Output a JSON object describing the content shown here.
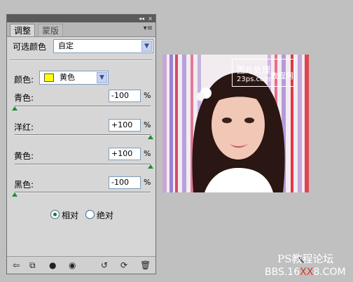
{
  "panel": {
    "tabs": [
      {
        "label": "调整",
        "active": true
      },
      {
        "label": "蒙版",
        "active": false
      }
    ],
    "title_controls": "◂◂",
    "close": "×",
    "menu_icon": "panel-menu-icon"
  },
  "adjustment": {
    "label": "可选颜色",
    "preset": "自定"
  },
  "colors": {
    "label": "颜色:",
    "selected": "黄色",
    "swatch_color": "#ffff00"
  },
  "sliders": [
    {
      "label": "青色:",
      "value": "-100",
      "unit": "%",
      "level": -100
    },
    {
      "label": "洋红:",
      "value": "+100",
      "unit": "%",
      "level": 100
    },
    {
      "label": "黄色:",
      "value": "+100",
      "unit": "%",
      "level": 100
    },
    {
      "label": "黑色:",
      "value": "-100",
      "unit": "%",
      "level": -100
    }
  ],
  "method": {
    "options": [
      "相对",
      "绝对"
    ],
    "selected": "相对"
  },
  "bottom_icons": [
    "back-arrow-icon",
    "clip-layer-icon",
    "layer-visibility-icon",
    "eye-icon",
    "previous-state-icon",
    "reset-icon",
    "delete-icon"
  ],
  "watermark": {
    "line1": "图片处理",
    "line2": "23ps.com",
    "line3": "教程网"
  },
  "forum": {
    "title": "PS教程论坛",
    "url_prefix": "BBS.16",
    "url_mid": "XX",
    "url_suffix": "8.COM"
  },
  "accent_colors": {
    "slider_thumb": "#1f8f2f",
    "forum_red": "#e03020"
  }
}
